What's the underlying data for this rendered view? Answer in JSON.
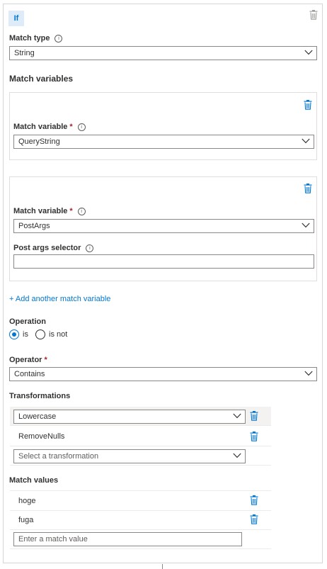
{
  "header": {
    "badge": "If"
  },
  "match_type": {
    "label": "Match type",
    "value": "String"
  },
  "match_variables": {
    "title": "Match variables",
    "cards": [
      {
        "label": "Match variable",
        "required_mark": "*",
        "value": "QueryString"
      },
      {
        "label": "Match variable",
        "required_mark": "*",
        "value": "PostArgs",
        "selector_label": "Post args selector",
        "selector_value": ""
      }
    ],
    "add_link": "+ Add another match variable"
  },
  "operation": {
    "label": "Operation",
    "options": [
      {
        "label": "is",
        "selected": true
      },
      {
        "label": "is not",
        "selected": false
      }
    ]
  },
  "operator": {
    "label": "Operator",
    "required_mark": "*",
    "value": "Contains"
  },
  "transformations": {
    "label": "Transformations",
    "rows": [
      "Lowercase",
      "RemoveNulls"
    ],
    "placeholder": "Select a transformation"
  },
  "match_values": {
    "label": "Match values",
    "rows": [
      "hoge",
      "fuga"
    ],
    "placeholder": "Enter a match value"
  },
  "colors": {
    "accent": "#0078d4",
    "required": "#a4262c",
    "border": "#8a8886"
  },
  "icons": {
    "delete": "trash-icon",
    "info": "info-icon",
    "dropdown": "chevron-down-icon"
  }
}
